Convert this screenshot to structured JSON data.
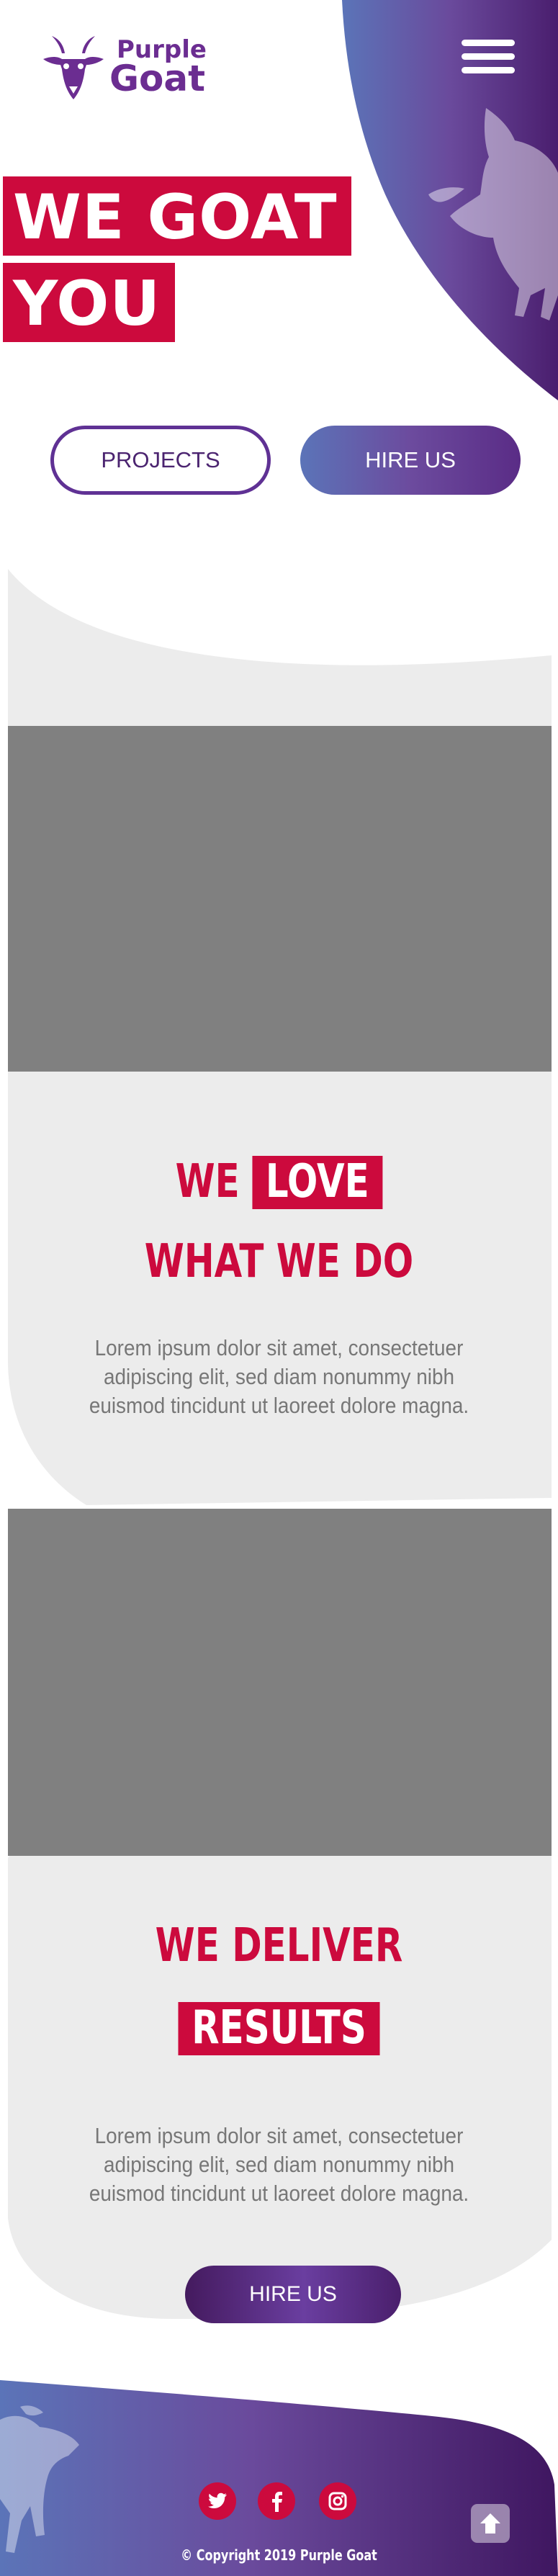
{
  "brand": {
    "name_line1": "Purple",
    "name_line2": "Goat",
    "color_primary": "#6b2d91",
    "color_accent": "#cc0a3d",
    "logo_icon": "goat-head-icon"
  },
  "header": {
    "menu_icon": "hamburger-menu-icon"
  },
  "hero": {
    "headline_line1": "WE GOAT",
    "headline_line2": "YOU",
    "projects_label": "PROJECTS",
    "hire_label": "HIRE US"
  },
  "section_love": {
    "title_word1": "WE",
    "title_highlight": "LOVE",
    "title_line2": "WHAT WE DO",
    "body": "Lorem ipsum dolor sit amet, consectetuer adipiscing elit, sed diam nonummy nibh euismod tincidunt ut laoreet dolore magna."
  },
  "section_results": {
    "title_line1": "WE DELIVER",
    "title_highlight": "RESULTS",
    "body": "Lorem ipsum dolor sit amet, consectetuer adipiscing elit, sed diam nonummy nibh euismod tincidunt ut laoreet dolore magna.",
    "hire_label": "HIRE US"
  },
  "footer": {
    "social": [
      {
        "icon": "twitter-icon"
      },
      {
        "icon": "facebook-icon"
      },
      {
        "icon": "instagram-icon"
      }
    ],
    "copyright": "© Copyright 2019 Purple Goat",
    "to_top_icon": "arrow-up-icon"
  }
}
